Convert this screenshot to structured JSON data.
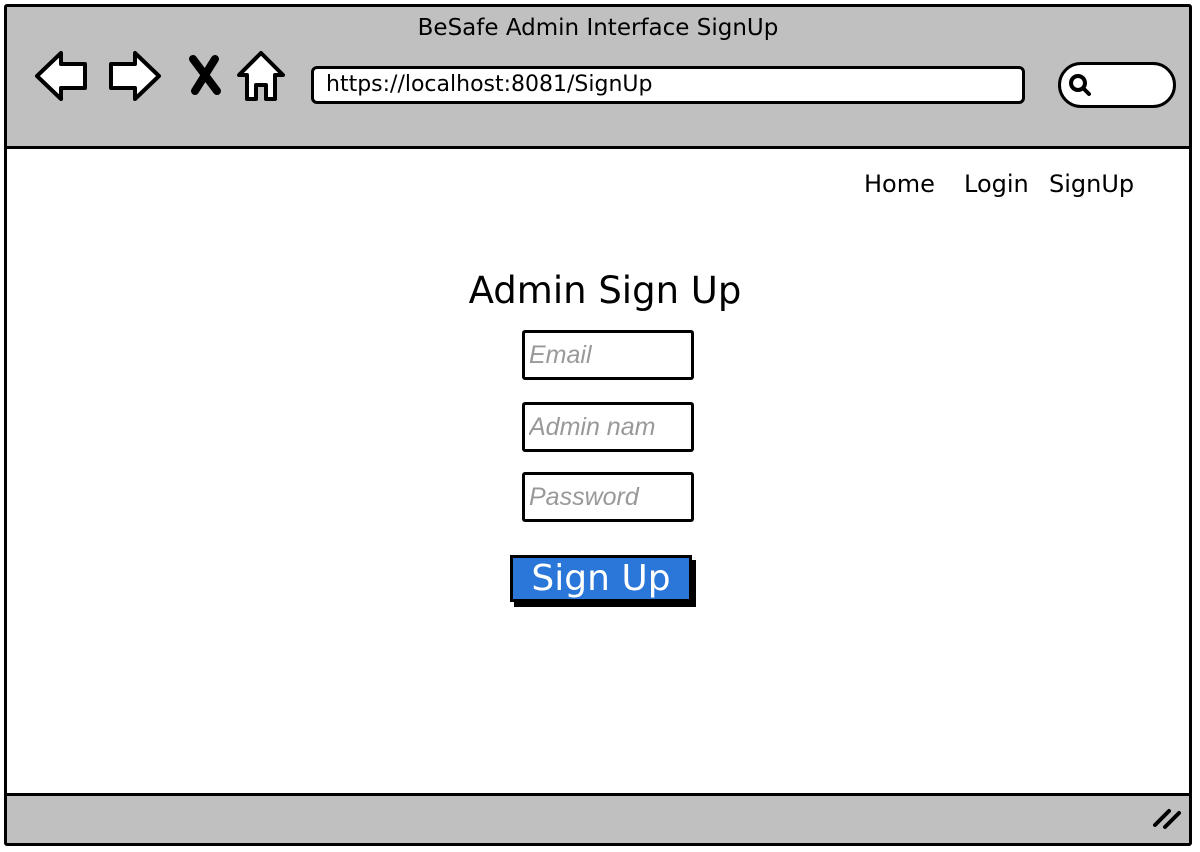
{
  "window": {
    "title": "BeSafe Admin Interface SignUp"
  },
  "browser": {
    "url": "https://localhost:8081/SignUp",
    "search_value": "",
    "icons": {
      "back": "back-arrow-icon",
      "forward": "forward-arrow-icon",
      "stop": "close-icon",
      "home": "home-icon",
      "search": "search-icon",
      "resize": "resize-grip-icon"
    }
  },
  "nav": {
    "home": "Home",
    "login": "Login",
    "signup": "SignUp"
  },
  "form": {
    "heading": "Admin Sign Up",
    "email_placeholder": "Email",
    "admin_name_placeholder": "Admin nam",
    "password_placeholder": "Password",
    "submit_label": "Sign Up"
  },
  "colors": {
    "chrome": "#c0c0c0",
    "button": "#2b77d9",
    "placeholder": "#999999"
  }
}
